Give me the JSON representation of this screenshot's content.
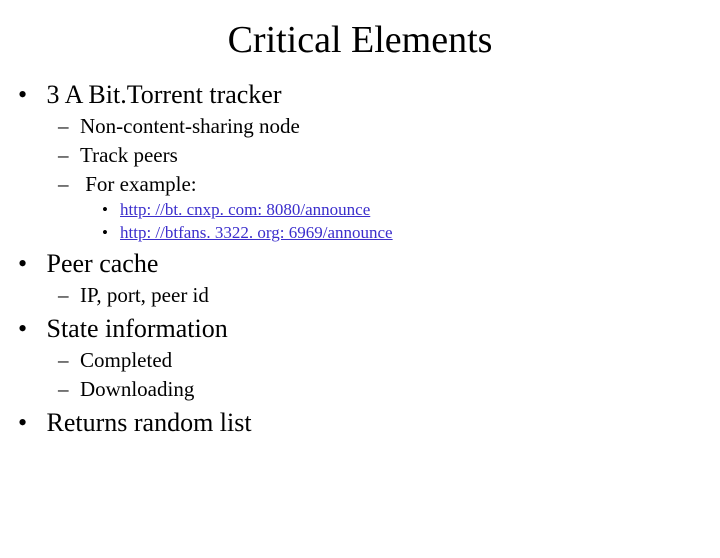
{
  "title": "Critical Elements",
  "bullets": {
    "b1": "3 A Bit.Torrent tracker",
    "b1_sub": {
      "s1": "Non-content-sharing node",
      "s2": "Track  peers",
      "s3": "For example:",
      "s3_links": {
        "l1": "http: //bt. cnxp. com: 8080/announce",
        "l2": "http: //btfans. 3322. org: 6969/announce"
      }
    },
    "b2": "Peer cache",
    "b2_sub": {
      "s1": "IP, port, peer id"
    },
    "b3": "State information",
    "b3_sub": {
      "s1": "Completed",
      "s2": "Downloading"
    },
    "b4": "Returns random list"
  }
}
